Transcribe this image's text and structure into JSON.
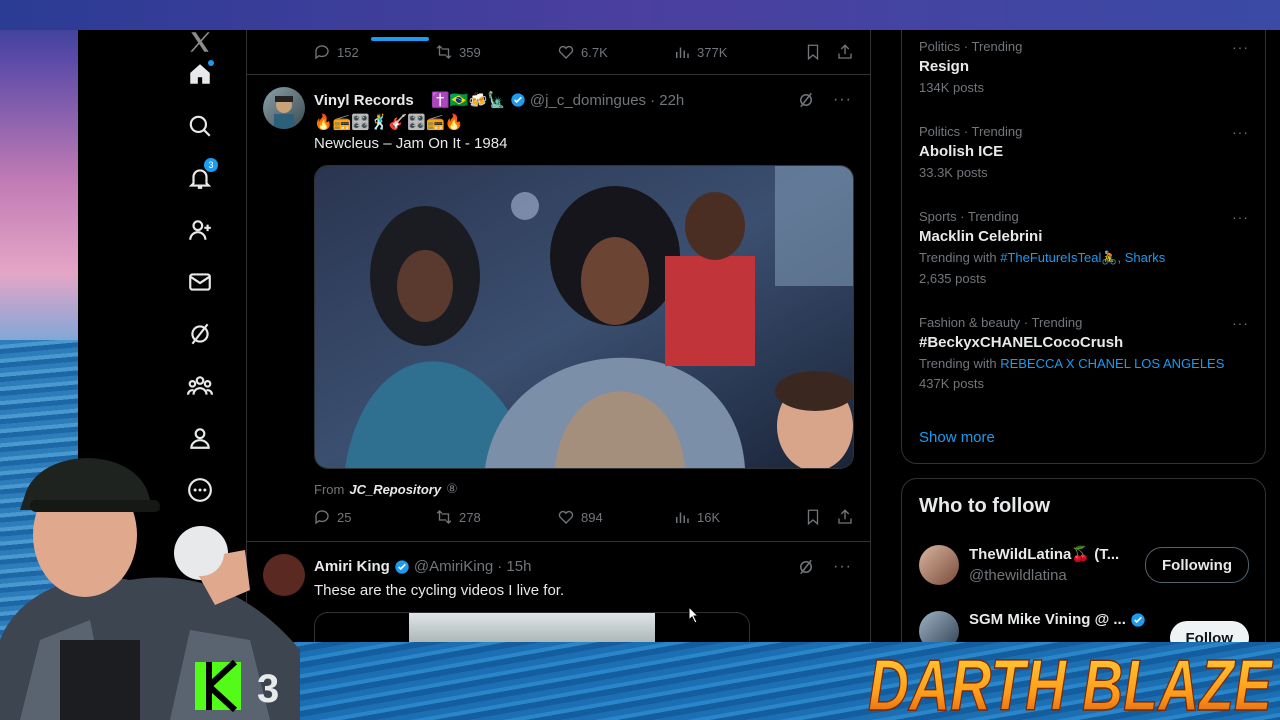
{
  "colors": {
    "accent": "#1d9bf0",
    "bg": "#000000",
    "text": "#e7e9ea",
    "muted": "#71767b"
  },
  "nav": {
    "items": [
      "home-icon",
      "search-icon",
      "notifications-icon",
      "follow-icon",
      "messages-icon",
      "grok-icon",
      "communities-icon",
      "profile-icon",
      "more-icon"
    ],
    "notifications_badge": "3"
  },
  "feed": {
    "top_actions": {
      "replies": "152",
      "reposts": "359",
      "likes": "6.7K",
      "views": "377K"
    },
    "tweet1": {
      "name": "Vinyl Records",
      "name_emoji": "⑧✝️🇧🇷🍻🗽",
      "handle": "@j_c_domingues",
      "time": "· 22h",
      "emoji_line": "🔥📻🎛️🕺🎸🎛️📻🔥",
      "text": "Newcleus – Jam On It - 1984",
      "from_prefix": "From",
      "from_source": "JC_Repository",
      "from_badge": "⑧",
      "replies": "25",
      "reposts": "278",
      "likes": "894",
      "views": "16K"
    },
    "tweet2": {
      "name": "Amiri King",
      "handle": "@AmiriKing",
      "time": "· 15h",
      "text": "These are the cycling videos I live for."
    }
  },
  "trends": [
    {
      "category": "Politics · Trending",
      "title": "Resign",
      "posts": "134K posts"
    },
    {
      "category": "Politics · Trending",
      "title": "Abolish ICE",
      "posts": "33.3K posts"
    },
    {
      "category": "Sports · Trending",
      "title": "Macklin Celebrini",
      "with_prefix": "Trending with",
      "with_links": "#TheFutureIsTeal🚴, Sharks",
      "posts": "2,635 posts"
    },
    {
      "category": "Fashion & beauty · Trending",
      "title": "#BeckyxCHANELCocoCrush",
      "with_prefix": "Trending with",
      "with_links": "REBECCA X CHANEL LOS ANGELES",
      "posts": "437K posts"
    }
  ],
  "show_more": "Show more",
  "who_to_follow": {
    "title": "Who to follow",
    "users": [
      {
        "name": "TheWildLatina🍒 (T...",
        "handle": "@thewildlatina",
        "button": "Following"
      },
      {
        "name": "SGM Mike Vining @ ...",
        "handle": "",
        "button": "Follow"
      }
    ]
  },
  "overlay": {
    "stream_logo": "K 3",
    "banner": "DARTH BLAZE"
  }
}
